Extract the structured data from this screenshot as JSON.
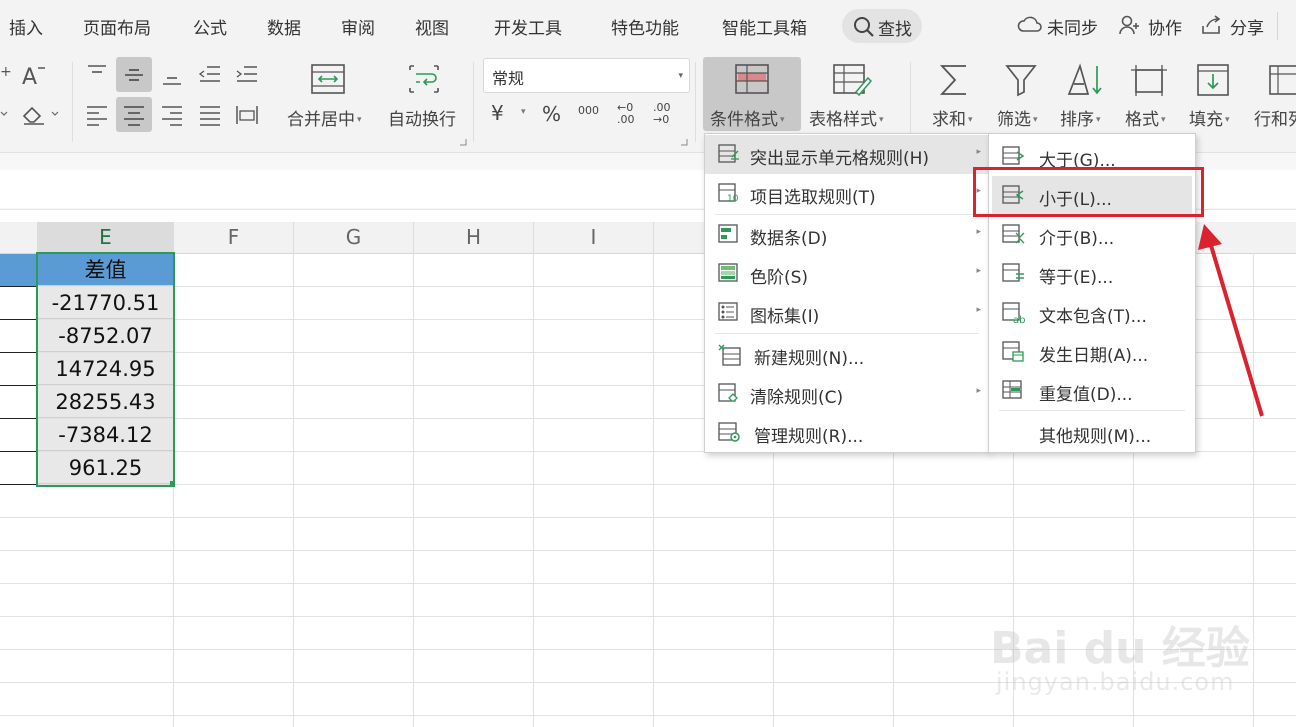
{
  "menu_tabs": [
    "插入",
    "页面布局",
    "公式",
    "数据",
    "审阅",
    "视图",
    "开发工具",
    "特色功能",
    "智能工具箱"
  ],
  "search_label": "查找",
  "header_right": {
    "sync": "未同步",
    "collab": "协作",
    "share": "分享"
  },
  "ribbon": {
    "merge_center": "合并居中",
    "auto_wrap": "自动换行",
    "number_format": "常规",
    "currency_symbol": "¥",
    "percent_symbol": "%",
    "thousands_symbol": "000",
    "decimal_increase": "←0 .00",
    "decimal_decrease": ".00 →0",
    "conditional_format": "条件格式",
    "table_style": "表格样式",
    "sum": "求和",
    "filter": "筛选",
    "sort": "排序",
    "format": "格式",
    "fill": "填充",
    "row_col": "行和列"
  },
  "columns": [
    "E",
    "F",
    "G",
    "H",
    "I"
  ],
  "cells": {
    "header": "差值",
    "values": [
      "-21770.51",
      "-8752.07",
      "14724.95",
      "28255.43",
      "-7384.12",
      "961.25"
    ]
  },
  "cf_menu": [
    "突出显示单元格规则(H)",
    "项目选取规则(T)",
    "数据条(D)",
    "色阶(S)",
    "图标集(I)",
    "新建规则(N)...",
    "清除规则(C)",
    "管理规则(R)..."
  ],
  "highlight_submenu": [
    "大于(G)...",
    "小于(L)...",
    "介于(B)...",
    "等于(E)...",
    "文本包含(T)...",
    "发生日期(A)...",
    "重复值(D)...",
    "其他规则(M)..."
  ],
  "watermark": {
    "brand": "Bai du 经验",
    "url": "jingyan.baidu.com"
  },
  "colors": {
    "accent_green": "#2e9a5a",
    "header_blue": "#5b9bd5",
    "annotation_red": "#d9232e"
  }
}
